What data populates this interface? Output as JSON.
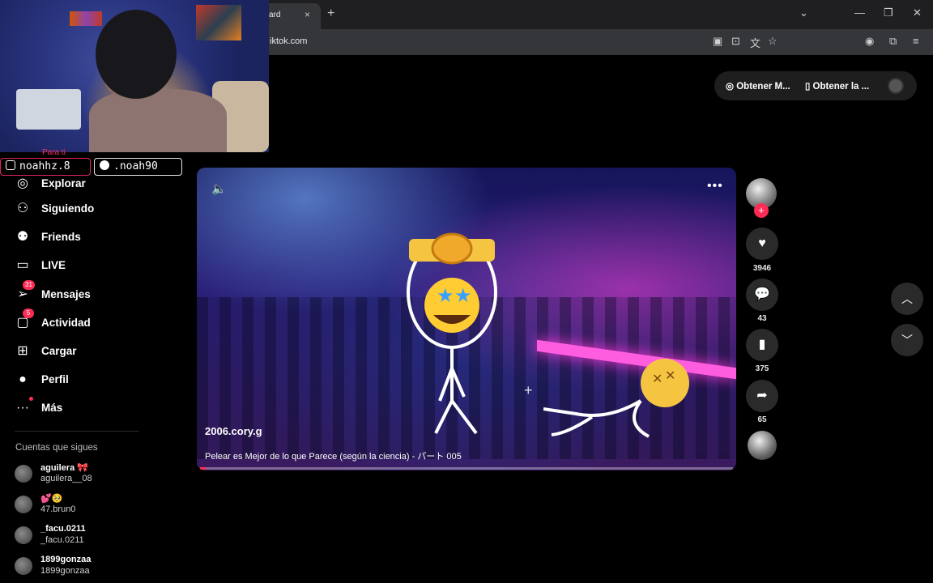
{
  "browser": {
    "tab_title": "ard",
    "tab_close": "×",
    "new_tab": "+",
    "url": "iktok.com"
  },
  "overlay": {
    "instagram": "noahhz.8",
    "kick": ".noah90"
  },
  "sidebar": {
    "partial_label": "Para ti",
    "items": [
      {
        "label": "Explorar",
        "icon": "compass-icon"
      },
      {
        "label": "Siguiendo",
        "icon": "person-follow-icon"
      },
      {
        "label": "Friends",
        "icon": "friends-icon"
      },
      {
        "label": "LIVE",
        "icon": "live-tv-icon"
      },
      {
        "label": "Mensajes",
        "icon": "messages-icon",
        "badge": "31"
      },
      {
        "label": "Actividad",
        "icon": "activity-icon",
        "badge": "5"
      },
      {
        "label": "Cargar",
        "icon": "upload-icon"
      },
      {
        "label": "Perfil",
        "icon": "profile-icon"
      },
      {
        "label": "Más",
        "icon": "more-dots-icon"
      }
    ],
    "following_title": "Cuentas que sigues",
    "following": [
      {
        "name": "aguilera 🎀",
        "handle": "aguilera__08"
      },
      {
        "name": "💕🥺",
        "handle": "47.brun0"
      },
      {
        "name": "_facu.0211",
        "handle": "_facu.0211"
      },
      {
        "name": "1899gonzaa",
        "handle": "1899gonzaa"
      }
    ]
  },
  "top_actions": {
    "btn1": "Obtener M...",
    "btn2": "Obtener la ..."
  },
  "video": {
    "author": "2006.cory.g",
    "caption": "Pelear es Mejor de lo que Parece (según la ciencia) - パート 005",
    "progress": 0.01
  },
  "actions": {
    "likes": "3946",
    "comments": "43",
    "saves": "375",
    "shares": "65"
  },
  "colors": {
    "accent": "#fe2c55",
    "background": "#000000"
  }
}
